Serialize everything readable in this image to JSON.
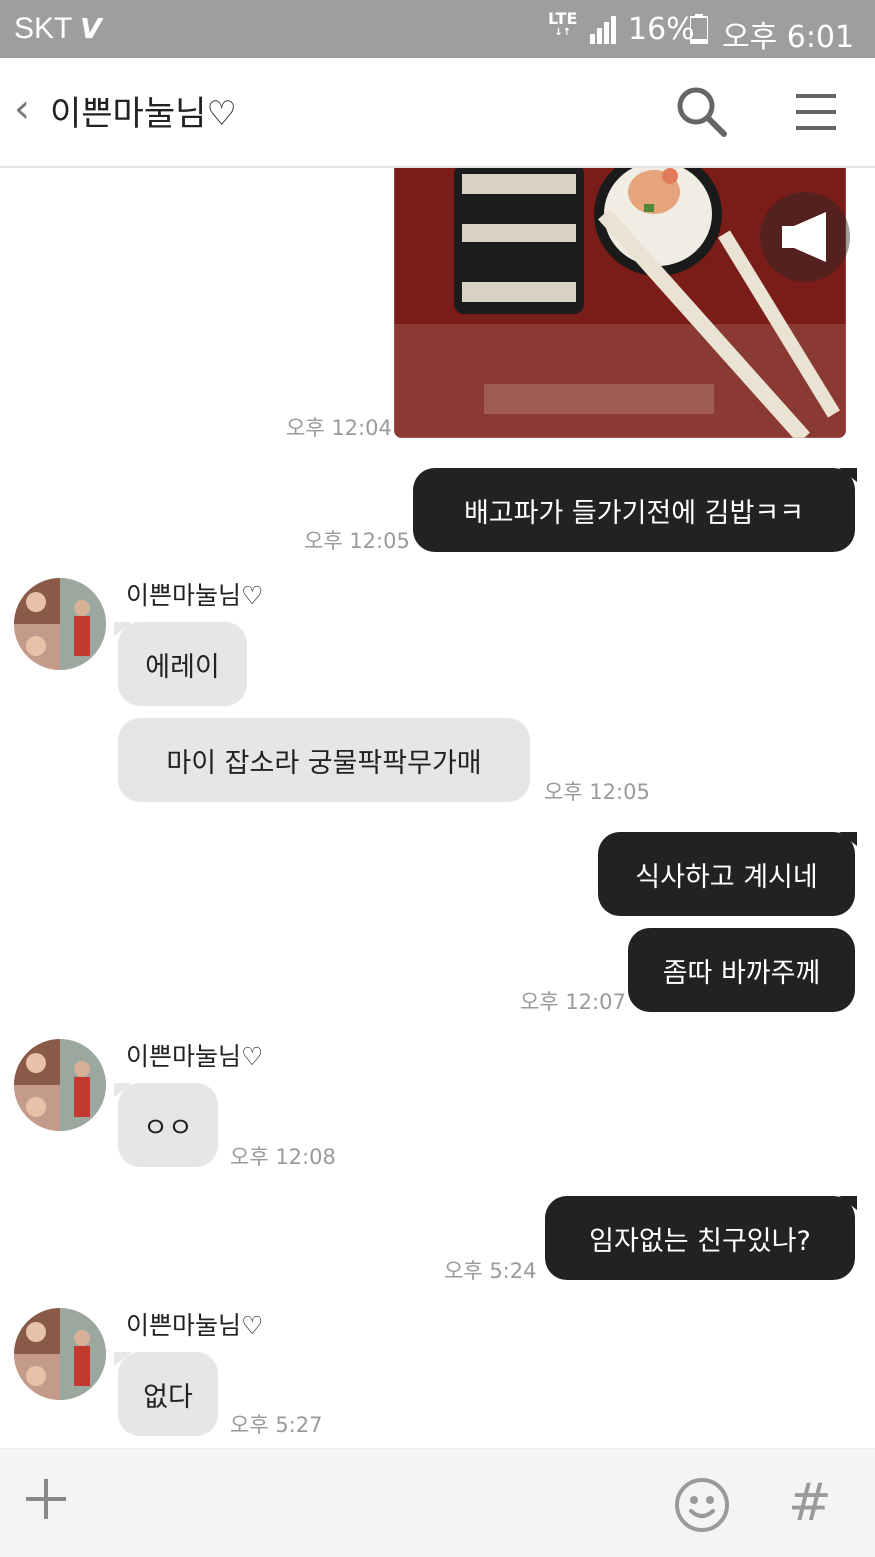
{
  "status_bar": {
    "carrier": "SKT",
    "carrier_logo": "V",
    "network": "LTE",
    "battery": "16%",
    "clock": "오후 6:01",
    "icons": [
      "signal-icon",
      "battery-icon"
    ]
  },
  "header": {
    "title": "이쁜마눌님♡",
    "icons": [
      "back-icon",
      "search-icon",
      "menu-icon"
    ]
  },
  "messages": [
    {
      "from": "me",
      "type": "photo",
      "time": "오후 12:04",
      "icon": "announce-icon"
    },
    {
      "from": "me",
      "text": "배고파가 들가기전에 김밥ㅋㅋ",
      "time": "오후 12:05"
    },
    {
      "from": "other",
      "sender": "이쁜마눌님♡",
      "text": "에레이"
    },
    {
      "from": "other",
      "text": "마이 잡소라 궁물팍팍무가매",
      "time": "오후 12:05"
    },
    {
      "from": "me",
      "text": "식사하고 계시네"
    },
    {
      "from": "me",
      "text": "좀따 바까주께",
      "time": "오후 12:07"
    },
    {
      "from": "other",
      "sender": "이쁜마눌님♡",
      "text": "ㅇㅇ",
      "time": "오후 12:08"
    },
    {
      "from": "me",
      "text": "임자없는 친구있나?",
      "time": "오후 5:24"
    },
    {
      "from": "other",
      "sender": "이쁜마눌님♡",
      "text": "없다",
      "time": "오후 5:27"
    }
  ],
  "input_bar": {
    "hash_label": "#",
    "icons": [
      "plus-icon",
      "emoji-icon",
      "hash-icon"
    ]
  },
  "colors": {
    "status_bar": "#9e9e9e",
    "my_bubble": "#222222",
    "other_bubble": "#e6e6e6",
    "timestamp": "#9a9a9a"
  }
}
